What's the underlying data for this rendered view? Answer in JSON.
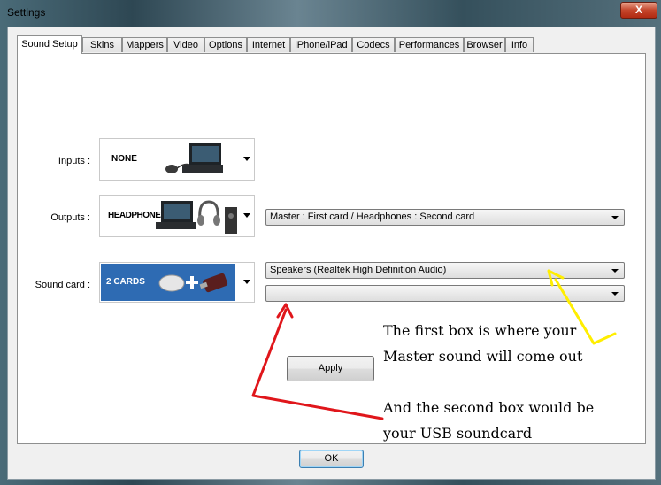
{
  "window": {
    "title": "Settings",
    "close_label": "X"
  },
  "tabs": [
    {
      "label": "Sound Setup",
      "active": true
    },
    {
      "label": "Skins"
    },
    {
      "label": "Mappers"
    },
    {
      "label": "Video"
    },
    {
      "label": "Options"
    },
    {
      "label": "Internet"
    },
    {
      "label": "iPhone/iPad"
    },
    {
      "label": "Codecs"
    },
    {
      "label": "Performances"
    },
    {
      "label": "Browser"
    },
    {
      "label": "Info"
    }
  ],
  "inputs": {
    "label": "Inputs :",
    "selected": "NONE"
  },
  "outputs": {
    "label": "Outputs :",
    "selected": "HEADPHONES",
    "mode": "Master : First card / Headphones : Second card"
  },
  "soundcard": {
    "label": "Sound card :",
    "selected": "2 CARDS",
    "card1": "Speakers (Realtek High Definition Audio)",
    "card2": ""
  },
  "apply_label": "Apply",
  "ok_label": "OK",
  "annotations": {
    "line1": "The first box is where your",
    "line2": "Master sound will come out",
    "line3": "And the second box would be",
    "line4": "your USB soundcard",
    "arrow_yellow": "#ffee00",
    "arrow_red": "#e0161b"
  }
}
